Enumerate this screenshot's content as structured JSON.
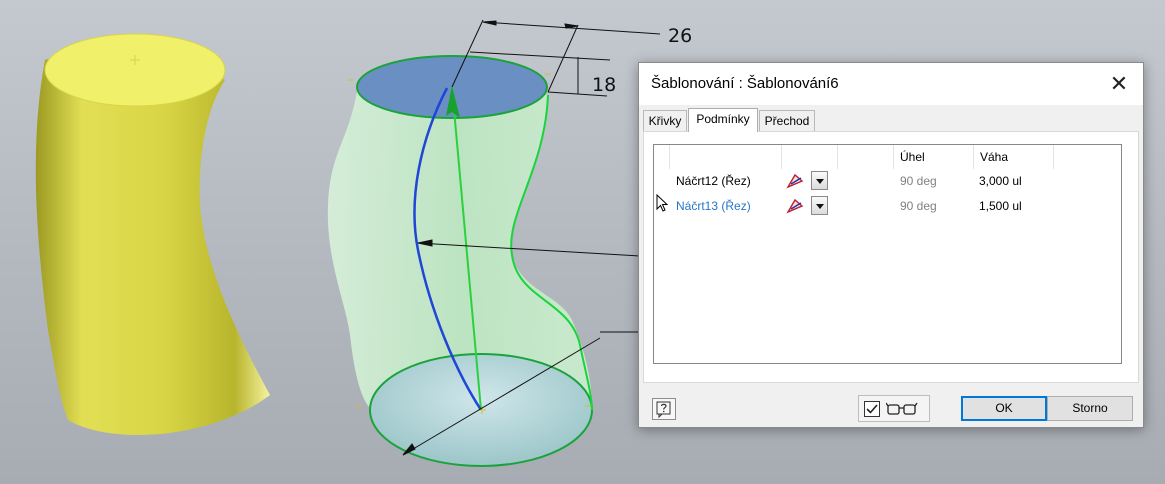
{
  "viewport": {
    "dim_top": "26",
    "dim_side": "18"
  },
  "dialog": {
    "title": "Šablonování : Šablonování6",
    "tabs": [
      "Křivky",
      "Podmínky",
      "Přechod"
    ],
    "active_tab": "Podmínky",
    "columns": {
      "angle": "Úhel",
      "weight": "Váha"
    },
    "rows": [
      {
        "name": "Náčrt12 (Řez)",
        "angle": "90 deg",
        "weight": "3,000 ul",
        "highlight": false
      },
      {
        "name": "Náčrt13 (Řez)",
        "angle": "90 deg",
        "weight": "1,500 ul",
        "highlight": true
      }
    ],
    "ok_label": "OK",
    "cancel_label": "Storno",
    "close_glyph": "✕"
  },
  "colors": {
    "accent": "#0078d7",
    "highlight_text": "#2677c9",
    "body_yellow": "#e4e155",
    "loft_green": "#bde6c2",
    "section_blue": "#6a8fc3"
  }
}
